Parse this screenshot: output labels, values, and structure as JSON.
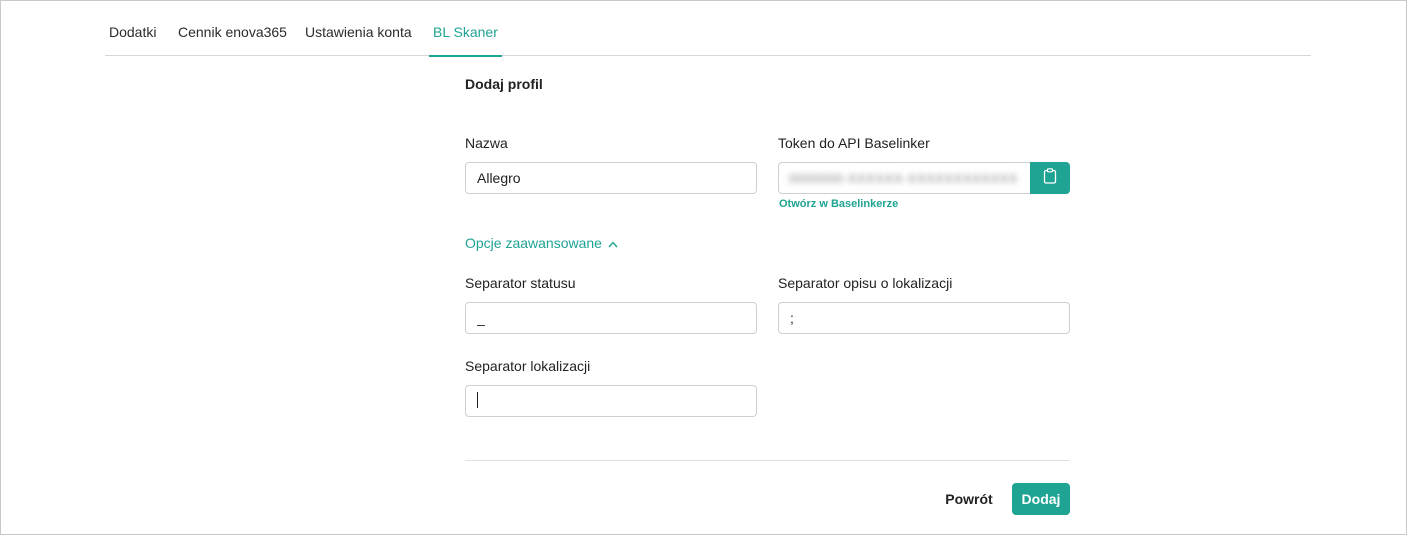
{
  "tabs": [
    {
      "label": "Dodatki"
    },
    {
      "label": "Cennik enova365"
    },
    {
      "label": "Ustawienia konta"
    },
    {
      "label": "BL Skaner",
      "active": true
    }
  ],
  "form": {
    "title": "Dodaj profil",
    "name_label": "Nazwa",
    "name_value": "Allegro",
    "token_label": "Token do API Baselinker",
    "token_value": "0000000-XXXXXX-XXXXXXXXXXXX",
    "token_copy_icon": "clipboard-icon",
    "open_in_baselinker": "Otwórz w Baselinkerze",
    "advanced_label": "Opcje zaawansowane",
    "advanced_icon": "chevron-up-icon",
    "status_separator_label": "Separator statusu",
    "status_separator_value": "_",
    "location_desc_separator_label": "Separator opisu o lokalizacji",
    "location_desc_separator_value": ";",
    "location_separator_label": "Separator lokalizacji",
    "location_separator_value": ""
  },
  "actions": {
    "back_label": "Powrót",
    "add_label": "Dodaj"
  },
  "colors": {
    "accent": "#1fa393"
  }
}
